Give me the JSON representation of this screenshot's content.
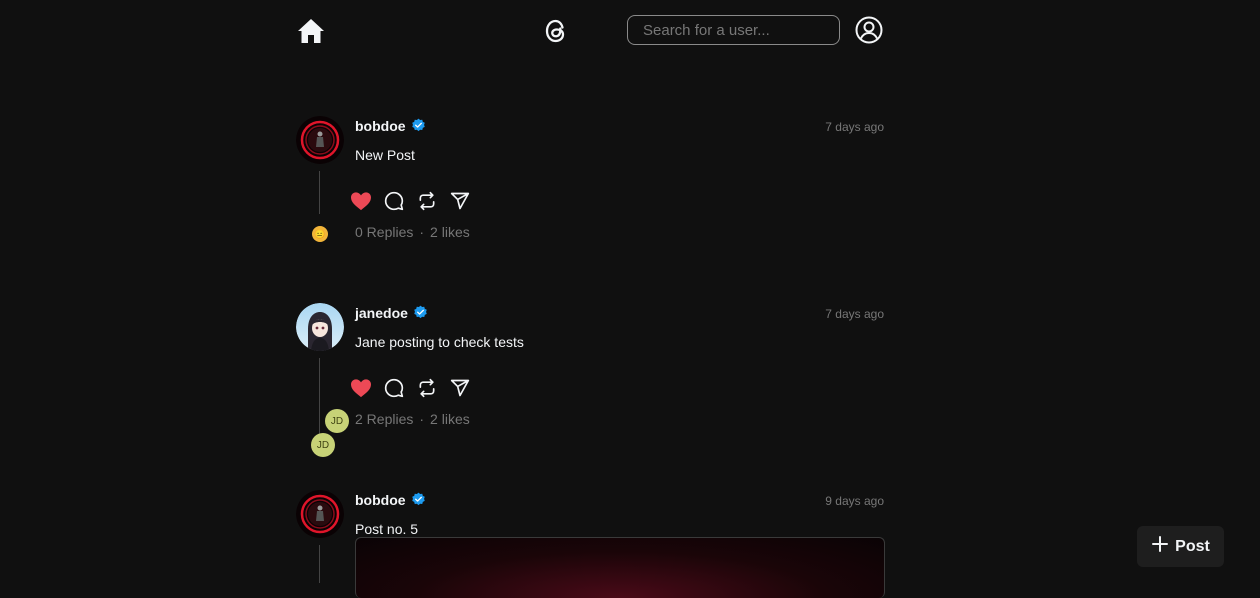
{
  "header": {
    "search_placeholder": "Search for a user..."
  },
  "posts": [
    {
      "username": "bobdoe",
      "time": "7 days ago",
      "text": "New Post",
      "replies": "0 Replies",
      "likes": "2 likes",
      "liked": true,
      "reply_avatars": [
        "😑"
      ]
    },
    {
      "username": "janedoe",
      "time": "7 days ago",
      "text": "Jane posting to check tests",
      "replies": "2 Replies",
      "likes": "2 likes",
      "liked": true,
      "reply_avatars": [
        "JD",
        "JD"
      ]
    },
    {
      "username": "bobdoe",
      "time": "9 days ago",
      "text": "Post no. 5"
    }
  ],
  "fab": {
    "label": "Post"
  },
  "colors": {
    "background": "#101010",
    "like": "#ed4956",
    "verified": "#1d9bf0",
    "muted": "#777777"
  }
}
